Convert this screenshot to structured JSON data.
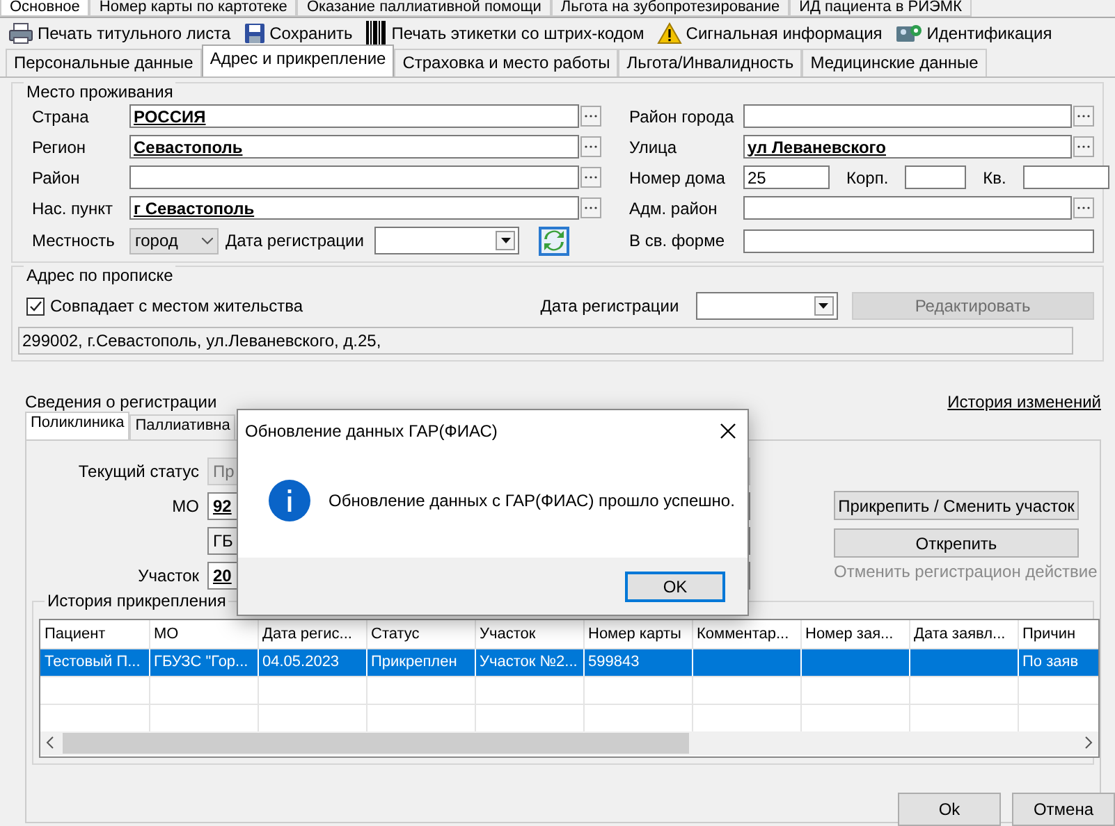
{
  "top_tabs": [
    {
      "label": "Основное",
      "selected": true
    },
    {
      "label": "Номер карты по картотеке",
      "selected": false
    },
    {
      "label": "Оказание паллиативной помощи",
      "selected": false
    },
    {
      "label": "Льгота на зубопротезирование",
      "selected": false
    },
    {
      "label": "ИД пациента в РИЭМК",
      "selected": false
    }
  ],
  "toolbar": [
    "Печать титульного листа",
    "Сохранить",
    "Печать этикетки со штрих-кодом",
    "Сигнальная информация",
    "Идентификация"
  ],
  "tabs": [
    {
      "label": "Персональные данные",
      "selected": false
    },
    {
      "label": "Адрес и прикрепление",
      "selected": true
    },
    {
      "label": "Страховка и место работы",
      "selected": false
    },
    {
      "label": "Льгота/Инвалидность",
      "selected": false
    },
    {
      "label": "Медицинские данные",
      "selected": false
    }
  ],
  "residence": {
    "title": "Место проживания",
    "left": [
      {
        "label": "Страна",
        "value": "РОССИЯ"
      },
      {
        "label": "Регион",
        "value": "Севастополь"
      },
      {
        "label": "Район"
      },
      {
        "label": "Нас. пункт",
        "value": "г Севастополь"
      }
    ],
    "locality": {
      "label": "Местность",
      "value": "город"
    },
    "reg_date": {
      "label": "Дата регистрации"
    },
    "right": [
      {
        "kind": "lookup",
        "label": "Район города"
      },
      {
        "kind": "lookup",
        "label": "Улица",
        "value": "ул Леваневского"
      },
      {
        "kind": "house",
        "label": "Номер дома",
        "value": "25",
        "building_label": "Корп.",
        "flat_label": "Кв."
      },
      {
        "kind": "lookup",
        "label": "Адм. район"
      },
      {
        "kind": "text",
        "label": "В св. форме"
      }
    ]
  },
  "registration_address": {
    "title": "Адрес по прописке",
    "same_as_residence": {
      "label": "Совпадает с местом жительства",
      "checked": true
    },
    "reg_date": {
      "label": "Дата регистрации"
    },
    "edit_button": {
      "label": "Редактировать",
      "disabled": true
    },
    "address": "299002, г.Севастополь, ул.Леваневского, д.25,"
  },
  "registration_info": {
    "title": "Сведения о регистрации",
    "history_link": "История изменений",
    "subtabs": [
      {
        "label": "Поликлиника",
        "selected": true
      },
      {
        "label": "Паллиативна",
        "selected": false
      }
    ],
    "status": {
      "label": "Текущий статус",
      "value": "Пр"
    },
    "mo": {
      "label": "МО",
      "value": "92",
      "name_value": "ГБ"
    },
    "district": {
      "label": "Участок",
      "value": "20"
    },
    "attach_button": "Прикрепить / Сменить участок",
    "detach_button": "Открепить",
    "cancel_link": {
      "label": "Отменить регистрацион действие",
      "disabled": true
    },
    "history": {
      "title": "История прикрепления",
      "columns": [
        "Пациент",
        "МО",
        "Дата регис...",
        "Статус",
        "Участок",
        "Номер карты",
        "Комментар...",
        "Номер зая...",
        "Дата заявл...",
        "Причин"
      ],
      "rows": [
        {
          "selected": true,
          "cells": [
            "Тестовый П...",
            "ГБУЗС \"Гор...",
            "04.05.2023",
            "Прикреплен",
            "Участок №2...",
            "599843",
            "",
            "",
            "",
            "По заяв"
          ]
        }
      ]
    }
  },
  "footer": [
    "Ok",
    "Отмена"
  ],
  "dialog": {
    "title": "Обновление данных ГАР(ФИАС)",
    "message": "Обновление данных с ГАР(ФИАС) прошло успешно.",
    "button": "OK"
  }
}
